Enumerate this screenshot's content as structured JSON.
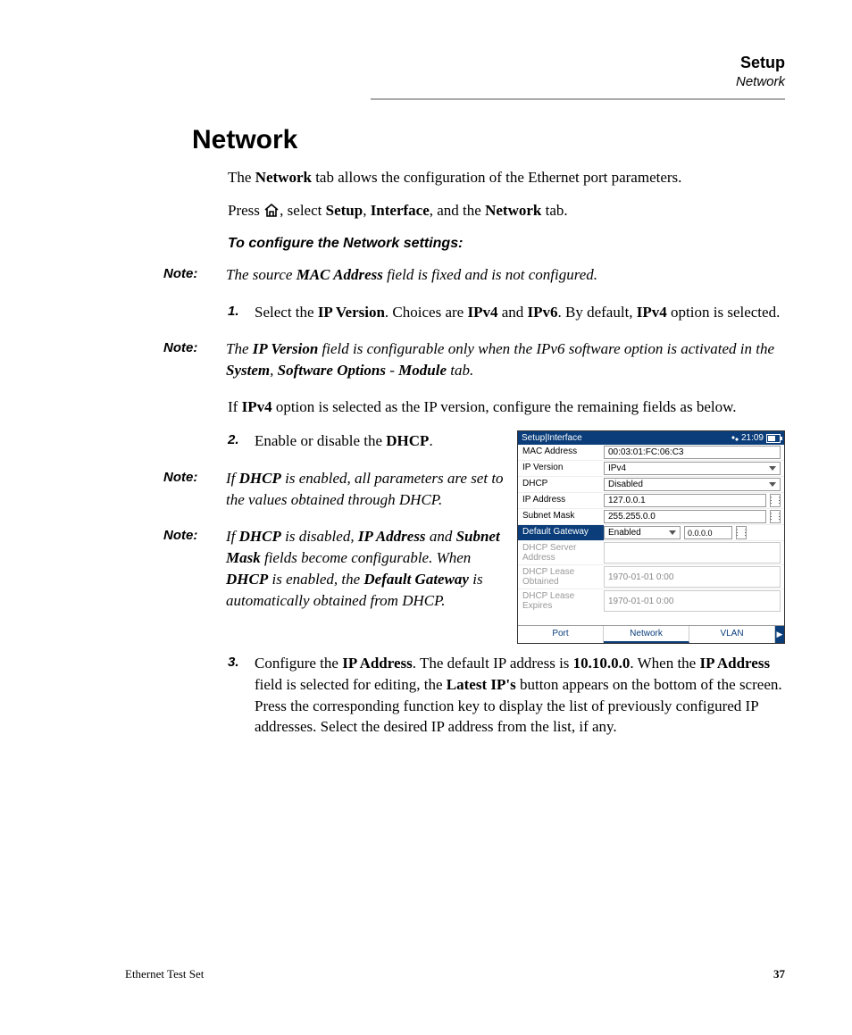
{
  "header": {
    "title": "Setup",
    "sub": "Network"
  },
  "section_title": "Network",
  "intro": {
    "p1_a": "The ",
    "p1_b": "Network",
    "p1_c": " tab allows the configuration of the Ethernet port parameters.",
    "p2_a": "Press ",
    "p2_b": ", select ",
    "p2_c": "Setup",
    "p2_d": ", ",
    "p2_e": "Interface",
    "p2_f": ", and the ",
    "p2_g": "Network",
    "p2_h": " tab."
  },
  "subhead": "To configure the Network settings:",
  "note1": {
    "label": "Note:",
    "a": "The source ",
    "b": "MAC Address",
    "c": " field is fixed and is not configured."
  },
  "step1": {
    "num": "1.",
    "a": "Select the ",
    "b": "IP Version",
    "c": ". Choices are ",
    "d": "IPv4",
    "e": " and ",
    "f": "IPv6",
    "g": ". By default, ",
    "h": "IPv4",
    "i": " option is selected."
  },
  "note2": {
    "label": "Note:",
    "a": "The ",
    "b": "IP Version",
    "c": " field is configurable only when the IPv6 software option is activated in the ",
    "d": "System",
    "e": ", ",
    "f": "Software Options",
    "g": " - ",
    "h": "Module",
    "i": " tab."
  },
  "p3": {
    "a": "If ",
    "b": "IPv4",
    "c": " option is selected as the IP version, configure the remaining fields as below."
  },
  "step2": {
    "num": "2.",
    "a": "Enable or disable the ",
    "b": "DHCP",
    "c": "."
  },
  "note3": {
    "label": "Note:",
    "a": "If ",
    "b": "DHCP",
    "c": " is enabled, all parameters are set to the values obtained through DHCP."
  },
  "note4": {
    "label": "Note:",
    "a": "If ",
    "b": "DHCP",
    "c": " is disabled, ",
    "d": "IP Address",
    "e": " and ",
    "f": "Subnet Mask",
    "g": " fields become configurable. When ",
    "h": "DHCP",
    "i": " is enabled, the ",
    "j": "Default Gateway",
    "k": " is automatically obtained from DHCP."
  },
  "step3": {
    "num": "3.",
    "a": "Configure the ",
    "b": "IP Address",
    "c": ". The default IP address is ",
    "d": "10.10.0.0",
    "e": ". When the ",
    "f": "IP Address",
    "g": " field is selected for editing, the ",
    "h": "Latest IP's",
    "i": " button appears on the bottom of the screen. Press the corresponding function key to display the list of previously configured IP addresses. Select the desired IP address from the list, if any."
  },
  "figure": {
    "breadcrumb": "Setup|Interface",
    "time": "21:09",
    "rows": {
      "mac": {
        "label": "MAC Address",
        "value": "00:03:01:FC:06:C3"
      },
      "ipver": {
        "label": "IP Version",
        "value": "IPv4"
      },
      "dhcp": {
        "label": "DHCP",
        "value": "Disabled"
      },
      "ipaddr": {
        "label": "IP Address",
        "value": "127.0.0.1"
      },
      "subnet": {
        "label": "Subnet Mask",
        "value": "255.255.0.0"
      },
      "gw": {
        "label": "Default Gateway",
        "value": "Enabled",
        "extra": "0.0.0.0"
      },
      "dsrv": {
        "label": "DHCP Server Address",
        "value": ""
      },
      "dobt": {
        "label": "DHCP Lease Obtained",
        "value": "1970-01-01 0:00"
      },
      "dexp": {
        "label": "DHCP Lease Expires",
        "value": "1970-01-01 0:00"
      }
    },
    "tabs": {
      "port": "Port",
      "network": "Network",
      "vlan": "VLAN"
    }
  },
  "footer": {
    "doc": "Ethernet Test Set",
    "page": "37"
  }
}
